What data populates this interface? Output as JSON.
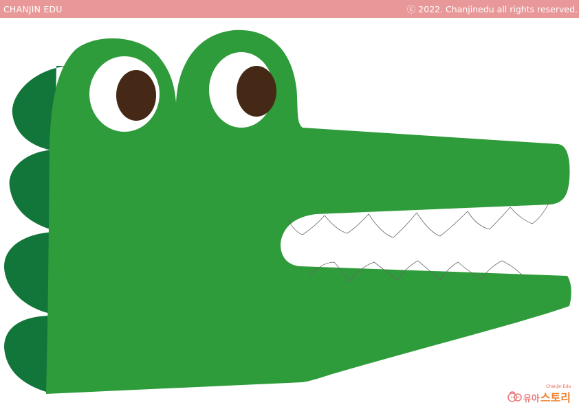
{
  "header": {
    "brand": "CHANJIN EDU",
    "copyright": "ⓒ 2022. Chanjinedu all rights reserved."
  },
  "illustration": {
    "subject": "crocodile",
    "colors": {
      "body": "#2e9c3a",
      "back_bumps": "#12753a",
      "eye_white": "#ffffff",
      "pupil": "#452815",
      "mouth": "#ffffff",
      "teeth_outline": "#666666"
    }
  },
  "logo": {
    "tagline": "Chanjin Edu",
    "text_a": "유아",
    "text_b": "스토리"
  }
}
